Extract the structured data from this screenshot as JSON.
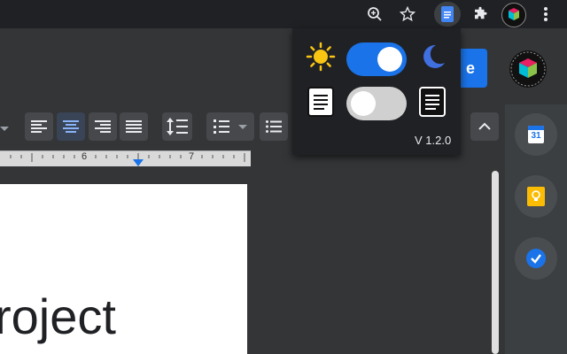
{
  "browser": {
    "zoom_icon": "magnify-icon",
    "bookmark_icon": "star-icon",
    "extensions_icon": "puzzle-icon",
    "menu_icon": "kebab-menu-icon"
  },
  "docs": {
    "share_label": "e",
    "ruler_numbers": [
      "6",
      "7"
    ],
    "document_text": "roject"
  },
  "side_panel": {
    "calendar_day": "31"
  },
  "popup": {
    "version": "V 1.2.0",
    "theme_toggle_on": true,
    "page_toggle_on": false
  },
  "colors": {
    "accent_blue": "#1a73e8",
    "sun_yellow": "#f9c513",
    "moon_blue": "#3f6fe0"
  }
}
